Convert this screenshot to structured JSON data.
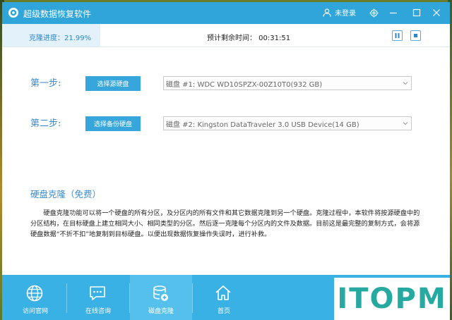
{
  "window": {
    "title": "超级数据恢复软件",
    "user_label": "未登录"
  },
  "progress": {
    "label": "克隆进度：21.99%",
    "fraction": 0.2199,
    "eta": "预计剩余时间：   00:31:51"
  },
  "steps": [
    {
      "label": "第一步:",
      "button": "选择源硬盘",
      "disk": "磁盘 #1: WDC WD10SPZX-00Z10T0(932 GB)"
    },
    {
      "label": "第二步:",
      "button": "选择备份硬盘",
      "disk": "磁盘 #2: Kingston DataTraveler 3.0 USB Device(14 GB)"
    }
  ],
  "section": {
    "title": "硬盘克隆（免费）",
    "description": "硬盘克隆功能可以将一个硬盘的所有分区，及分区内的所有文件和其它数据克隆到另一个硬盘。克隆过程中，本软件将按源硬盘中的分区结构，在目标硬盘上建立相同大小、相同类型的分区。然后逐一克隆每个分区内的文件及数据。目前这是最完整的复制方式，会将源硬盘数据“不折不扣”地复制到目标硬盘。以便出现数据恢复操作失误时，进行补救。"
  },
  "nav": [
    {
      "label": "访问官网",
      "icon": "globe-icon"
    },
    {
      "label": "在线咨询",
      "icon": "chat-icon"
    },
    {
      "label": "磁盘克隆",
      "icon": "disk-clone-icon"
    },
    {
      "label": "首页",
      "icon": "home-icon"
    }
  ],
  "brand": {
    "text": "ITOPM"
  },
  "colors": {
    "accent": "#2fa5da",
    "nav_bg": "#3ab1e5",
    "brand": "#26a9a0"
  }
}
